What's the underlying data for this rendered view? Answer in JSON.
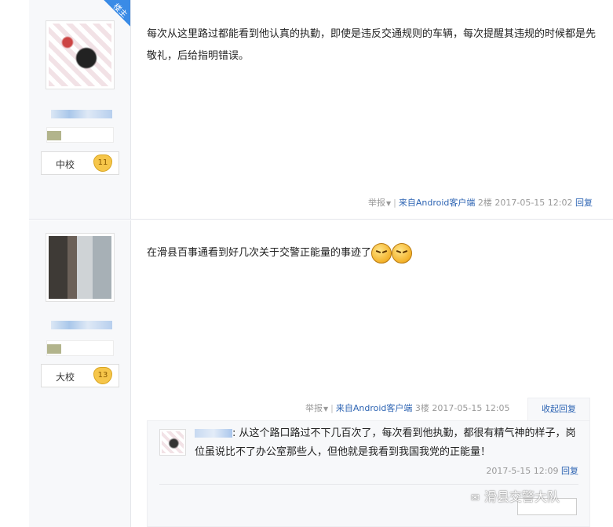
{
  "posts": [
    {
      "owner_tag": "楼主",
      "rank": {
        "name": "中校",
        "level": "11"
      },
      "content": "每次从这里路过都能看到他认真的执勤，即使是违反交通规则的车辆，每次提醒其违规的时候都是先敬礼，后给指明错误。",
      "meta": {
        "report": "举报",
        "source": "来自Android客户端",
        "floor": "2楼",
        "time": "2017-05-15 12:02",
        "reply": "回复"
      }
    },
    {
      "rank": {
        "name": "大校",
        "level": "13"
      },
      "content": "在滑县百事通看到好几次关于交警正能量的事迹了",
      "meta": {
        "report": "举报",
        "source": "来自Android客户端",
        "floor": "3楼",
        "time": "2017-05-15 12:05",
        "collapse": "收起回复"
      },
      "sub_reply": {
        "text": ": 从这个路口路过不下几百次了，每次看到他执勤，都很有精气神的样子，岗位虽说比不了办公室那些人，但他就是我看到我国我党的正能量！",
        "time": "2017-5-15 12:09",
        "reply": "回复"
      }
    }
  ],
  "watermark": {
    "text": "滑县交警大队"
  },
  "colors": {
    "link": "#2d64b3",
    "meta": "#999999",
    "side_bg": "#f7f8fa",
    "owner_tag": "#3a8be6"
  }
}
